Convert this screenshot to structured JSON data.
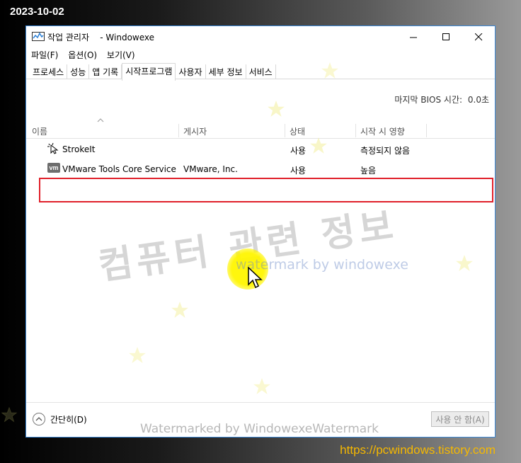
{
  "overlay": {
    "date": "2023-10-02",
    "url": "https://pcwindows.tistory.com",
    "watermark_big": "컴퓨터 관련 정보",
    "watermark_small": "watermark by windowexe",
    "watermark_bottom": "Watermarked by WindowexeWatermark"
  },
  "window": {
    "title": "작업 관리자    - Windowexe",
    "icon": "task-manager-icon",
    "controls": [
      "minimize-icon",
      "maximize-icon",
      "close-icon"
    ]
  },
  "menu": [
    "파일(F)",
    "옵션(O)",
    "보기(V)"
  ],
  "tabs": [
    {
      "label": "프로세스"
    },
    {
      "label": "성능"
    },
    {
      "label": "앱 기록"
    },
    {
      "label": "시작프로그램",
      "active": true
    },
    {
      "label": "사용자"
    },
    {
      "label": "세부 정보"
    },
    {
      "label": "서비스"
    }
  ],
  "bios": {
    "label": "마지막 BIOS 시간:",
    "value": "0.0초"
  },
  "columns": [
    "이름",
    "게시자",
    "상태",
    "시작 시 영향"
  ],
  "rows": [
    {
      "icon": "strokeit-cursor-icon",
      "name": "StrokeIt",
      "publisher": "",
      "status": "사용",
      "impact": "측정되지 않음"
    },
    {
      "icon": "vmware-icon",
      "icon_text": "vm",
      "name": "VMware Tools Core Service",
      "publisher": "VMware, Inc.",
      "status": "사용",
      "impact": "높음"
    }
  ],
  "footer": {
    "collapse_label": "간단히(D)",
    "disable_button": "사용 안 함(A)"
  },
  "colors": {
    "window_border": "#3c8ad9",
    "highlight": "#e0202a",
    "url": "#f6b800",
    "star": "#f3ef9a"
  }
}
